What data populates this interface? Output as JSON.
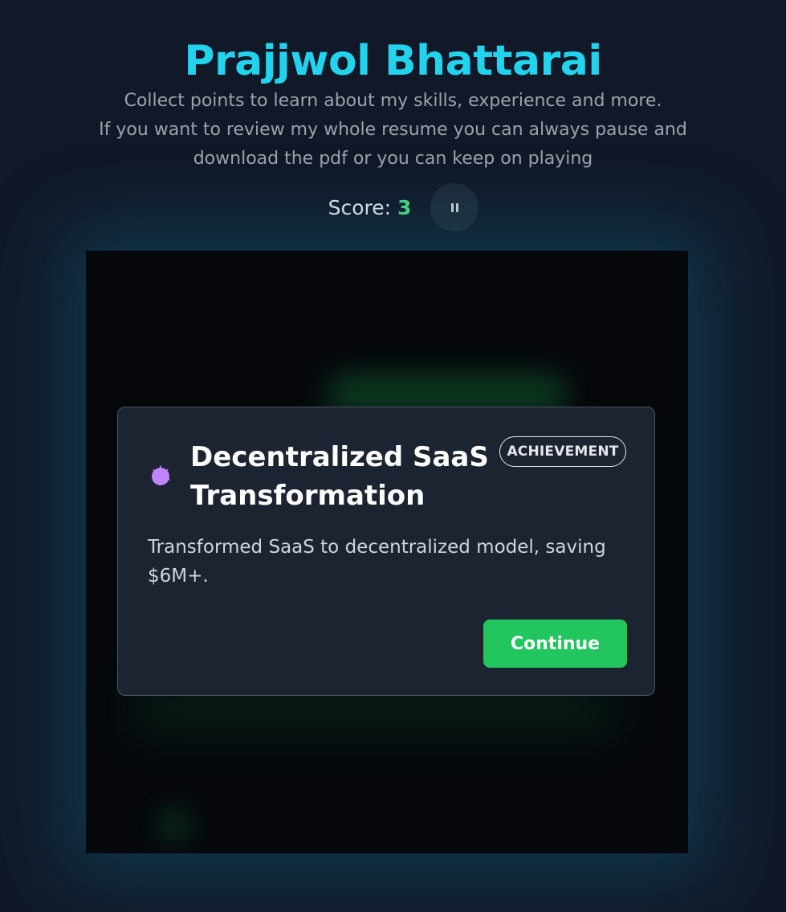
{
  "header": {
    "title": "Prajjwol Bhattarai",
    "subtitle_line1": "Collect points to learn about my skills, experience and more.",
    "subtitle_line2": "If you want to review my whole resume you can always pause and download the pdf or you can keep on playing"
  },
  "scoreboard": {
    "score_label": "Score:",
    "score_value": "3",
    "pause_icon": "pause-icon"
  },
  "modal": {
    "icon": "achievement-orb-icon",
    "title": "Decentralized SaaS Transformation",
    "badge": "ACHIEVEMENT",
    "description": "Transformed SaaS to decentralized model, saving $6M+.",
    "continue_label": "Continue"
  },
  "colors": {
    "accent_title": "#22d3ee",
    "score_value": "#4ade80",
    "continue_button": "#22c55e",
    "icon_orb": "#c084fc",
    "background": "#111827"
  }
}
